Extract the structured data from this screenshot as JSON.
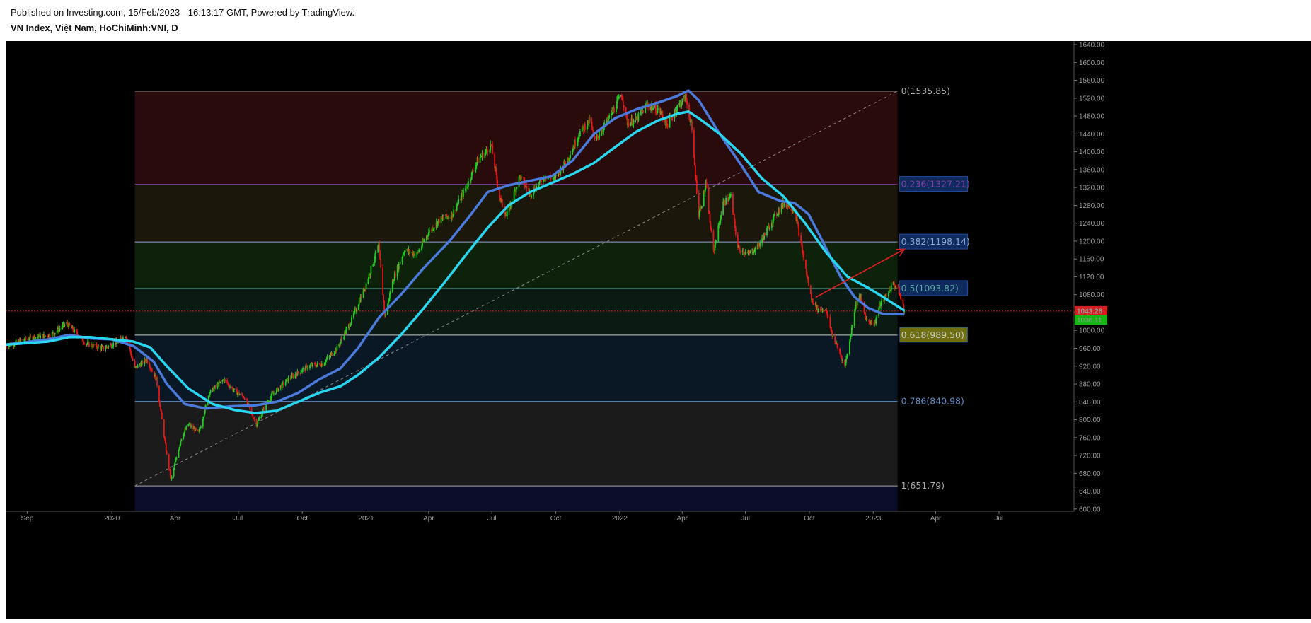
{
  "header": {
    "published": "Published on Investing.com, 15/Feb/2023 - 16:13:17 GMT, Powered by TradingView.",
    "symbol": "VN Index, Việt Nam, HoChiMinh:VNI, D"
  },
  "chart_data": {
    "type": "candlestick",
    "title": "VN Index, Việt Nam, HoChiMinh:VNI, D",
    "interval": "D",
    "ylim": [
      595,
      1648
    ],
    "y_ticks": [
      600,
      640,
      680,
      720,
      760,
      800,
      840,
      880,
      920,
      960,
      1000,
      1040,
      1080,
      1120,
      1160,
      1200,
      1240,
      1280,
      1320,
      1360,
      1400,
      1440,
      1480,
      1520,
      1560,
      1600,
      1640
    ],
    "y_tick_labels": [
      "600.00",
      "640.00",
      "680.00",
      "720.00",
      "760.00",
      "800.00",
      "840.00",
      "880.00",
      "920.00",
      "960.00",
      "1000.00",
      "1040.00",
      "1080.00",
      "1120.00",
      "1160.00",
      "1200.00",
      "1240.00",
      "1280.00",
      "1320.00",
      "1360.00",
      "1400.00",
      "1440.00",
      "1480.00",
      "1520.00",
      "1560.00",
      "1600.00",
      "1640.00"
    ],
    "x_ticks": [
      {
        "label": "Sep",
        "date": "2019-09-01"
      },
      {
        "label": "2020",
        "date": "2020-01-01"
      },
      {
        "label": "Apr",
        "date": "2020-04-01"
      },
      {
        "label": "Jul",
        "date": "2020-07-01"
      },
      {
        "label": "Oct",
        "date": "2020-10-01"
      },
      {
        "label": "2021",
        "date": "2021-01-01"
      },
      {
        "label": "Apr",
        "date": "2021-04-01"
      },
      {
        "label": "Jul",
        "date": "2021-07-01"
      },
      {
        "label": "Oct",
        "date": "2021-10-01"
      },
      {
        "label": "2022",
        "date": "2022-01-01"
      },
      {
        "label": "Apr",
        "date": "2022-04-01"
      },
      {
        "label": "Jul",
        "date": "2022-07-01"
      },
      {
        "label": "Oct",
        "date": "2022-10-01"
      },
      {
        "label": "2023",
        "date": "2023-01-01"
      },
      {
        "label": "Apr",
        "date": "2023-04-01"
      },
      {
        "label": "Jul",
        "date": "2023-07-01"
      }
    ],
    "xlim": [
      "2019-08-01",
      "2023-10-15"
    ],
    "price_path": [
      [
        "2019-08-01",
        965
      ],
      [
        "2019-08-20",
        975
      ],
      [
        "2019-09-10",
        985
      ],
      [
        "2019-10-05",
        990
      ],
      [
        "2019-10-28",
        1015
      ],
      [
        "2019-11-10",
        995
      ],
      [
        "2019-11-25",
        970
      ],
      [
        "2019-12-20",
        960
      ],
      [
        "2020-01-10",
        975
      ],
      [
        "2020-01-21",
        990
      ],
      [
        "2020-02-03",
        915
      ],
      [
        "2020-02-20",
        935
      ],
      [
        "2020-03-05",
        890
      ],
      [
        "2020-03-20",
        720
      ],
      [
        "2020-03-26",
        665
      ],
      [
        "2020-04-10",
        760
      ],
      [
        "2020-04-20",
        790
      ],
      [
        "2020-05-05",
        770
      ],
      [
        "2020-05-20",
        860
      ],
      [
        "2020-06-10",
        890
      ],
      [
        "2020-06-25",
        865
      ],
      [
        "2020-07-10",
        850
      ],
      [
        "2020-07-27",
        790
      ],
      [
        "2020-08-15",
        850
      ],
      [
        "2020-09-10",
        890
      ],
      [
        "2020-10-10",
        920
      ],
      [
        "2020-10-30",
        925
      ],
      [
        "2020-11-20",
        960
      ],
      [
        "2020-12-10",
        1020
      ],
      [
        "2020-12-31",
        1100
      ],
      [
        "2021-01-19",
        1190
      ],
      [
        "2021-01-28",
        1030
      ],
      [
        "2021-02-08",
        1110
      ],
      [
        "2021-02-25",
        1180
      ],
      [
        "2021-03-15",
        1170
      ],
      [
        "2021-04-01",
        1220
      ],
      [
        "2021-04-15",
        1245
      ],
      [
        "2021-05-05",
        1260
      ],
      [
        "2021-05-25",
        1320
      ],
      [
        "2021-06-10",
        1380
      ],
      [
        "2021-06-30",
        1415
      ],
      [
        "2021-07-12",
        1300
      ],
      [
        "2021-07-22",
        1255
      ],
      [
        "2021-08-10",
        1345
      ],
      [
        "2021-08-25",
        1305
      ],
      [
        "2021-09-15",
        1345
      ],
      [
        "2021-09-30",
        1340
      ],
      [
        "2021-10-20",
        1390
      ],
      [
        "2021-11-05",
        1445
      ],
      [
        "2021-11-19",
        1470
      ],
      [
        "2021-11-26",
        1425
      ],
      [
        "2021-12-15",
        1470
      ],
      [
        "2022-01-04",
        1528
      ],
      [
        "2022-01-12",
        1465
      ],
      [
        "2022-01-24",
        1470
      ],
      [
        "2022-02-10",
        1505
      ],
      [
        "2022-02-28",
        1490
      ],
      [
        "2022-03-10",
        1460
      ],
      [
        "2022-03-25",
        1500
      ],
      [
        "2022-04-06",
        1522
      ],
      [
        "2022-04-14",
        1460
      ],
      [
        "2022-04-25",
        1260
      ],
      [
        "2022-05-05",
        1325
      ],
      [
        "2022-05-16",
        1175
      ],
      [
        "2022-05-30",
        1285
      ],
      [
        "2022-06-10",
        1300
      ],
      [
        "2022-06-20",
        1185
      ],
      [
        "2022-07-05",
        1170
      ],
      [
        "2022-07-20",
        1190
      ],
      [
        "2022-08-10",
        1250
      ],
      [
        "2022-08-25",
        1285
      ],
      [
        "2022-09-10",
        1270
      ],
      [
        "2022-09-26",
        1135
      ],
      [
        "2022-10-04",
        1070
      ],
      [
        "2022-10-14",
        1045
      ],
      [
        "2022-10-24",
        1050
      ],
      [
        "2022-11-03",
        990
      ],
      [
        "2022-11-15",
        945
      ],
      [
        "2022-11-21",
        920
      ],
      [
        "2022-11-28",
        975
      ],
      [
        "2022-12-06",
        1055
      ],
      [
        "2022-12-13",
        1075
      ],
      [
        "2022-12-22",
        1025
      ],
      [
        "2023-01-03",
        1015
      ],
      [
        "2023-01-10",
        1055
      ],
      [
        "2023-01-20",
        1080
      ],
      [
        "2023-01-30",
        1105
      ],
      [
        "2023-02-06",
        1090
      ],
      [
        "2023-02-15",
        1043.28
      ]
    ],
    "series": [
      {
        "name": "",
        "color": "#4a7bdc",
        "path": [
          [
            "2019-08-01",
            968
          ],
          [
            "2019-10-01",
            980
          ],
          [
            "2019-11-01",
            990
          ],
          [
            "2019-12-01",
            982
          ],
          [
            "2020-01-01",
            980
          ],
          [
            "2020-02-01",
            965
          ],
          [
            "2020-03-01",
            930
          ],
          [
            "2020-03-20",
            880
          ],
          [
            "2020-04-15",
            835
          ],
          [
            "2020-05-15",
            825
          ],
          [
            "2020-06-20",
            830
          ],
          [
            "2020-07-25",
            832
          ],
          [
            "2020-08-25",
            840
          ],
          [
            "2020-09-25",
            860
          ],
          [
            "2020-10-25",
            890
          ],
          [
            "2020-11-25",
            915
          ],
          [
            "2020-12-20",
            960
          ],
          [
            "2021-01-20",
            1030
          ],
          [
            "2021-02-20",
            1080
          ],
          [
            "2021-03-25",
            1140
          ],
          [
            "2021-05-01",
            1200
          ],
          [
            "2021-06-01",
            1260
          ],
          [
            "2021-06-25",
            1310
          ],
          [
            "2021-07-25",
            1325
          ],
          [
            "2021-08-25",
            1335
          ],
          [
            "2021-09-25",
            1345
          ],
          [
            "2021-10-25",
            1380
          ],
          [
            "2021-11-25",
            1440
          ],
          [
            "2021-12-25",
            1475
          ],
          [
            "2022-01-25",
            1495
          ],
          [
            "2022-02-25",
            1510
          ],
          [
            "2022-03-25",
            1525
          ],
          [
            "2022-04-10",
            1537
          ],
          [
            "2022-04-25",
            1515
          ],
          [
            "2022-05-25",
            1440
          ],
          [
            "2022-06-25",
            1370
          ],
          [
            "2022-07-20",
            1310
          ],
          [
            "2022-08-20",
            1290
          ],
          [
            "2022-09-10",
            1285
          ],
          [
            "2022-09-30",
            1260
          ],
          [
            "2022-10-20",
            1200
          ],
          [
            "2022-11-15",
            1120
          ],
          [
            "2022-12-05",
            1075
          ],
          [
            "2022-12-25",
            1050
          ],
          [
            "2023-01-15",
            1037
          ],
          [
            "2023-02-15",
            1036
          ]
        ]
      },
      {
        "name": "",
        "color": "#29d6ef",
        "path": [
          [
            "2019-08-01",
            968
          ],
          [
            "2019-10-01",
            975
          ],
          [
            "2019-11-01",
            985
          ],
          [
            "2019-12-01",
            985
          ],
          [
            "2020-01-01",
            980
          ],
          [
            "2020-02-01",
            975
          ],
          [
            "2020-02-25",
            962
          ],
          [
            "2020-03-20",
            920
          ],
          [
            "2020-04-20",
            870
          ],
          [
            "2020-05-25",
            835
          ],
          [
            "2020-06-25",
            822
          ],
          [
            "2020-07-25",
            815
          ],
          [
            "2020-08-25",
            820
          ],
          [
            "2020-09-25",
            840
          ],
          [
            "2020-10-25",
            860
          ],
          [
            "2020-11-25",
            875
          ],
          [
            "2020-12-20",
            900
          ],
          [
            "2021-01-20",
            940
          ],
          [
            "2021-02-20",
            990
          ],
          [
            "2021-03-25",
            1050
          ],
          [
            "2021-04-25",
            1110
          ],
          [
            "2021-05-25",
            1170
          ],
          [
            "2021-06-25",
            1230
          ],
          [
            "2021-07-25",
            1280
          ],
          [
            "2021-08-25",
            1310
          ],
          [
            "2021-09-25",
            1330
          ],
          [
            "2021-10-25",
            1350
          ],
          [
            "2021-11-25",
            1375
          ],
          [
            "2021-12-25",
            1410
          ],
          [
            "2022-01-25",
            1445
          ],
          [
            "2022-02-25",
            1470
          ],
          [
            "2022-03-25",
            1485
          ],
          [
            "2022-04-10",
            1490
          ],
          [
            "2022-04-25",
            1475
          ],
          [
            "2022-05-25",
            1440
          ],
          [
            "2022-06-25",
            1395
          ],
          [
            "2022-07-25",
            1340
          ],
          [
            "2022-08-25",
            1300
          ],
          [
            "2022-09-25",
            1240
          ],
          [
            "2022-10-25",
            1175
          ],
          [
            "2022-11-25",
            1120
          ],
          [
            "2022-12-25",
            1095
          ],
          [
            "2023-01-15",
            1075
          ],
          [
            "2023-02-15",
            1044
          ]
        ]
      }
    ],
    "fibonacci": {
      "start_date": "2020-02-03",
      "end_date": "2023-02-05",
      "levels": [
        {
          "label": "0(1535.85)",
          "value": 1535.85,
          "color": "#a8a8a8",
          "fill": "#2a0b0b"
        },
        {
          "label": "0.236(1327.21)",
          "value": 1327.21,
          "color": "#7d3fa0",
          "fill": "#1c170b",
          "box": "#0e2a5e"
        },
        {
          "label": "0.382(1198.14)",
          "value": 1198.14,
          "color": "#8aa5d0",
          "fill": "#0e220b",
          "box": "#0e2a5e"
        },
        {
          "label": "0.5(1093.82)",
          "value": 1093.82,
          "color": "#5aa7a2",
          "fill": "#0b1a12",
          "box": "#0e2a5e"
        },
        {
          "label": "0.618(989.50)",
          "value": 989.5,
          "color": "#c9c9c9",
          "fill": "#0a1826",
          "box": "#6f6f0e"
        },
        {
          "label": "0.786(840.98)",
          "value": 840.98,
          "color": "#5d8ac0",
          "fill": "#1b1b1b"
        },
        {
          "label": "1(651.79)",
          "value": 651.79,
          "color": "#a8a8a8",
          "fill": "#0b0b2a"
        }
      ]
    },
    "trend_line": {
      "from": [
        "2020-02-03",
        651.79
      ],
      "to": [
        "2023-02-05",
        1535.85
      ],
      "color": "#8a8a8a"
    },
    "arrow": {
      "from": [
        "2022-10-10",
        1074
      ],
      "to": [
        "2023-02-15",
        1182
      ],
      "color": "#e02020"
    },
    "last_price": {
      "value": 1043.28,
      "label": "1043.28",
      "color": "#d61e1e"
    },
    "ma_label": {
      "value": 1036.11,
      "label": "1036.11",
      "color": "#17b517"
    },
    "up_color": "#22cc22",
    "down_color": "#e01818",
    "background": "#000000"
  }
}
